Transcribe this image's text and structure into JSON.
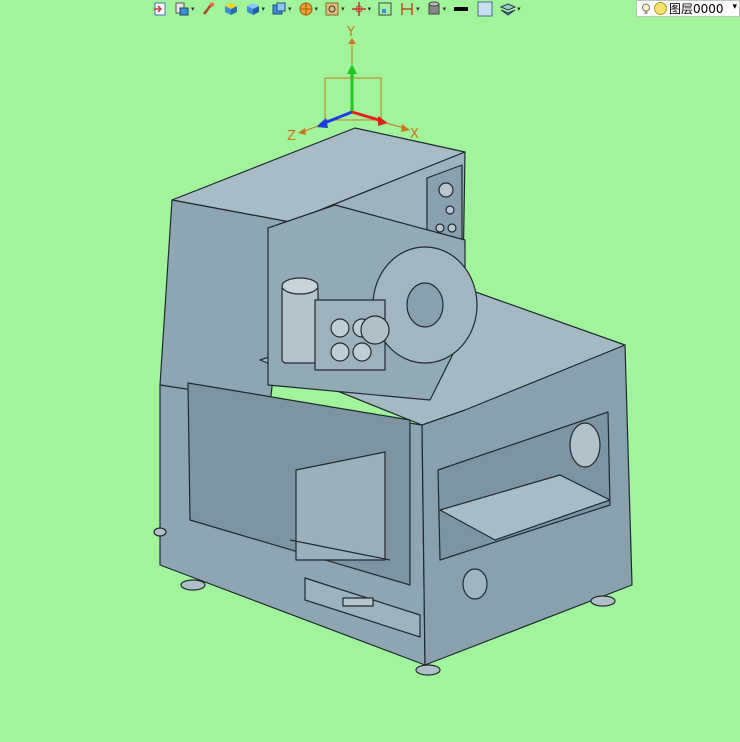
{
  "toolbar": {
    "buttons": [
      {
        "name": "import-icon",
        "dropdown": false
      },
      {
        "name": "assembly-icon",
        "dropdown": true
      },
      {
        "name": "paint-brush-icon",
        "dropdown": false
      },
      {
        "name": "color-cube-icon",
        "dropdown": false
      },
      {
        "name": "solid-cube-icon",
        "dropdown": true
      },
      {
        "name": "view-cube-icon",
        "dropdown": true
      },
      {
        "name": "render-sphere-icon",
        "dropdown": true
      },
      {
        "name": "zoom-fit-icon",
        "dropdown": true
      },
      {
        "name": "rotate-view-icon",
        "dropdown": true
      },
      {
        "name": "pan-view-icon",
        "dropdown": false
      },
      {
        "name": "section-view-icon",
        "dropdown": true
      },
      {
        "name": "cylinder-icon",
        "dropdown": true
      },
      {
        "name": "line-color-swatch",
        "dropdown": false
      },
      {
        "name": "fill-color-swatch",
        "dropdown": false
      },
      {
        "name": "layers-icon",
        "dropdown": true
      }
    ],
    "line_color": "#000000",
    "fill_color": "#c9dff0",
    "layer_name": "图层0000"
  },
  "viewport": {
    "background_color": "#a2f49c",
    "model_color": "#8fa6b2",
    "axes": {
      "y_label": "Y",
      "z_label": "Z",
      "x_label": "X",
      "y_color": "#1ec81e",
      "z_color": "#1e3ce6",
      "x_color": "#e61e1e"
    }
  }
}
